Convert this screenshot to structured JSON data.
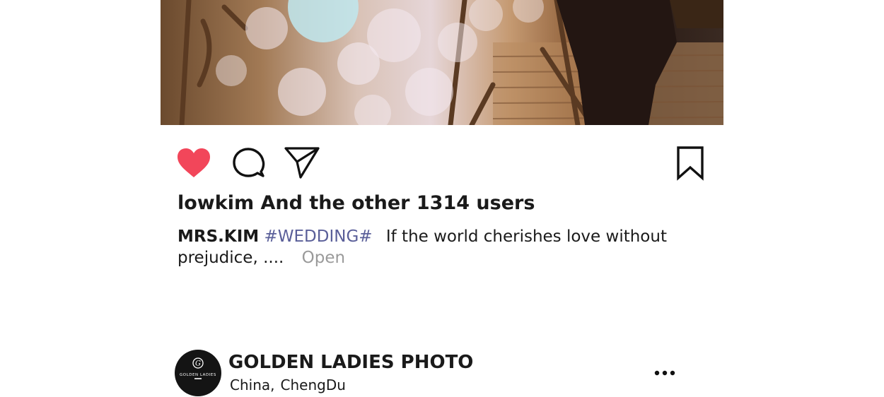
{
  "post": {
    "likes": {
      "user": "lowkim",
      "suffix": "And the other 1314 users"
    },
    "caption": {
      "author": "MRS.KIM",
      "hashtag": "#WEDDING#",
      "text": "If the world cherishes love without prejudice, ....",
      "more_label": "Open"
    },
    "liked": true
  },
  "account": {
    "name": "GOLDEN LADIES PHOTO",
    "location_country": "China",
    "location_separator": ",",
    "location_city": "ChengDu",
    "avatar_brand": "GOLDEN LADIES"
  },
  "icons": {
    "like": "heart-icon",
    "comment": "comment-icon",
    "share": "send-icon",
    "save": "bookmark-icon",
    "more": "more-dots-icon"
  },
  "colors": {
    "heart": "#f2465a",
    "hashtag": "#5a5f99",
    "muted": "#9a9a9a"
  }
}
